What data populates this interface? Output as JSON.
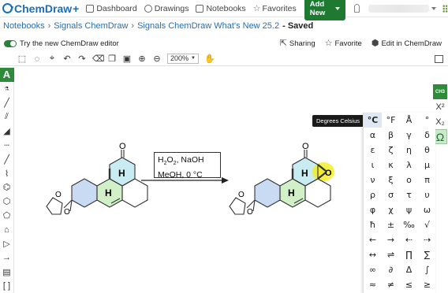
{
  "app": {
    "name": "ChemDraw",
    "plus": "+"
  },
  "nav": {
    "dashboard": "Dashboard",
    "drawings": "Drawings",
    "notebooks": "Notebooks",
    "favorites": "Favorites",
    "add_new": "Add New"
  },
  "breadcrumb": {
    "root": "Notebooks",
    "notebook": "Signals ChemDraw",
    "title": "Signals ChemDraw What's New 25.2",
    "status": "- Saved"
  },
  "editorbar": {
    "toggle_label": "Try the new ChemDraw editor",
    "sharing": "Sharing",
    "favorite": "Favorite",
    "edit_in": "Edit in ChemDraw"
  },
  "drawbar": {
    "zoom": "200%"
  },
  "tooltip": "Degrees Celsius",
  "reaction": {
    "line1_a": "H",
    "line1_sub1": "2",
    "line1_b": "O",
    "line1_sub2": "2",
    "line1_c": ", NaOH",
    "line2": "MeOH, 0 °C"
  },
  "symbols": [
    "°C",
    "°F",
    "Å",
    "°",
    "α",
    "β",
    "γ",
    "δ",
    "ε",
    "ζ",
    "η",
    "θ",
    "ι",
    "κ",
    "λ",
    "μ",
    "ν",
    "ξ",
    "ο",
    "π",
    "ρ",
    "σ",
    "τ",
    "υ",
    "φ",
    "χ",
    "ψ",
    "ω",
    "ħ",
    "±",
    "‰",
    "√",
    "←",
    "→",
    "⇠",
    "⇢",
    "↔",
    "⇌",
    "∏",
    "∑",
    "∞",
    "∂",
    "Δ",
    "∫",
    "≈",
    "≠",
    "≤",
    "≥"
  ],
  "right_palette": {
    "ch3": "CH3",
    "superscript": "X²",
    "subscript": "X₂",
    "omega": "Ω"
  },
  "left_palette": {
    "text_tool": "A"
  },
  "colors": {
    "brand": "#1a6fb5",
    "accent_green": "#2f8a3a",
    "ring_blue": "#c9dbf2",
    "ring_green": "#d2f0c8",
    "ring_cyan": "#c8ecf2",
    "epoxide_yellow": "#f2ef2a"
  }
}
